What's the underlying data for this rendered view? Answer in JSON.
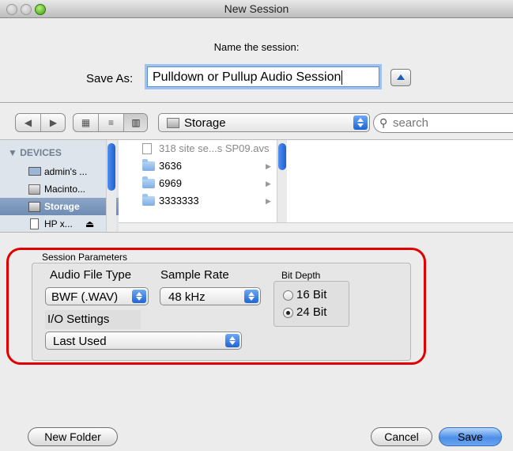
{
  "window": {
    "title": "New Session"
  },
  "sheet": {
    "prompt": "Name the session:",
    "save_as_label": "Save As:",
    "save_as_value": "Pulldown or Pullup Audio Session"
  },
  "toolbar": {
    "location": "Storage",
    "search_placeholder": "search"
  },
  "sidebar": {
    "section": "DEVICES",
    "items": [
      {
        "label": "admin's ...",
        "icon": "computer-icon"
      },
      {
        "label": "Macinto...",
        "icon": "disk-icon"
      },
      {
        "label": "Storage",
        "icon": "disk-icon",
        "selected": true
      },
      {
        "label": "HP x...",
        "icon": "external-disk-icon"
      }
    ]
  },
  "files": [
    {
      "name": "318 site se...s SP09.avs",
      "type": "document",
      "dimmed": true
    },
    {
      "name": "3636",
      "type": "folder"
    },
    {
      "name": "6969",
      "type": "folder"
    },
    {
      "name": "3333333",
      "type": "folder"
    }
  ],
  "params": {
    "title": "Session Parameters",
    "audio_file_type_label": "Audio File Type",
    "audio_file_type_value": "BWF (.WAV)",
    "sample_rate_label": "Sample Rate",
    "sample_rate_value": "48 kHz",
    "bit_depth_label": "Bit Depth",
    "bit_16": "16 Bit",
    "bit_24": "24 Bit",
    "bit_depth_selected": "24 Bit",
    "io_label": "I/O Settings",
    "io_value": "Last Used"
  },
  "buttons": {
    "new_folder": "New Folder",
    "cancel": "Cancel",
    "save": "Save"
  },
  "colors": {
    "highlight": "#e00000",
    "accent": "#1f64d6",
    "selection": "#7f97b9"
  }
}
